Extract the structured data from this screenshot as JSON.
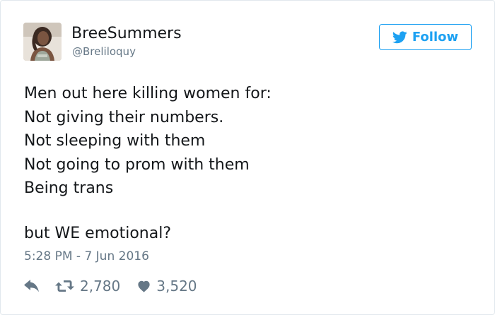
{
  "user": {
    "display_name": "BreeSummers",
    "handle": "@Breliloquy"
  },
  "follow_button": {
    "label": "Follow",
    "icon": "twitter-bird-icon"
  },
  "tweet": {
    "lines": [
      "Men out here killing women for:",
      "Not giving their numbers.",
      "Not sleeping with them",
      "Not going to prom with them",
      "Being trans",
      "but WE emotional?"
    ],
    "timestamp": "5:28 PM - 7 Jun 2016"
  },
  "actions": {
    "reply_icon": "reply-icon",
    "retweet_icon": "retweet-icon",
    "retweet_count": "2,780",
    "like_icon": "heart-icon",
    "like_count": "3,520"
  },
  "colors": {
    "accent": "#1da1f2",
    "text": "#14171a",
    "muted": "#657786",
    "border": "#e1e8ed"
  }
}
